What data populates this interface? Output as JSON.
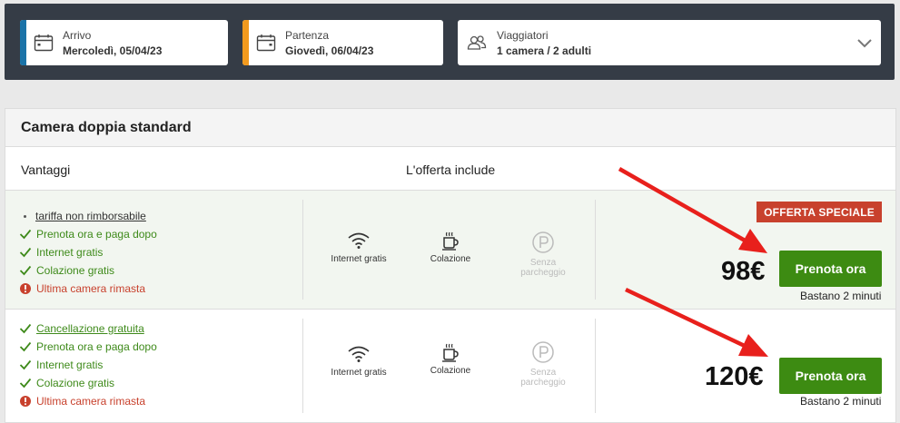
{
  "search": {
    "checkin": {
      "label": "Arrivo",
      "value": "Mercoledì, 05/04/23",
      "icon": "calendar-icon",
      "accent": "#1a73a8"
    },
    "checkout": {
      "label": "Partenza",
      "value": "Giovedì, 06/04/23",
      "icon": "calendar-icon",
      "accent": "#f29a1e"
    },
    "guests": {
      "label": "Viaggiatori",
      "value": "1 camera / 2 adulti",
      "icon": "users-icon"
    }
  },
  "room": {
    "title": "Camera doppia standard",
    "col_benefits": "Vantaggi",
    "col_includes": "L'offerta include"
  },
  "offers": [
    {
      "benefits": [
        {
          "text": "tariffa non rimborsabile",
          "kind": "bullet"
        },
        {
          "text": "Prenota ora e paga dopo",
          "kind": "check"
        },
        {
          "text": "Internet gratis",
          "kind": "check"
        },
        {
          "text": "Colazione gratis",
          "kind": "check"
        },
        {
          "text": "Ultima camera rimasta",
          "kind": "warning"
        }
      ],
      "amenities": [
        {
          "label": "Internet gratis",
          "icon": "wifi-icon",
          "available": true
        },
        {
          "label": "Colazione",
          "icon": "coffee-icon",
          "available": true
        },
        {
          "label": "Senza parcheggio",
          "icon": "parking-icon",
          "available": false
        }
      ],
      "badge": "OFFERTA SPECIALE",
      "price": "98€",
      "button": "Prenota ora",
      "hint": "Bastano 2 minuti"
    },
    {
      "benefits": [
        {
          "text": "Cancellazione gratuita",
          "kind": "check"
        },
        {
          "text": "Prenota ora e paga dopo",
          "kind": "check"
        },
        {
          "text": "Internet gratis",
          "kind": "check"
        },
        {
          "text": "Colazione gratis",
          "kind": "check"
        },
        {
          "text": "Ultima camera rimasta",
          "kind": "warning"
        }
      ],
      "amenities": [
        {
          "label": "Internet gratis",
          "icon": "wifi-icon",
          "available": true
        },
        {
          "label": "Colazione",
          "icon": "coffee-icon",
          "available": true
        },
        {
          "label": "Senza parcheggio",
          "icon": "parking-icon",
          "available": false
        }
      ],
      "price": "120€",
      "button": "Prenota ora",
      "hint": "Bastano 2 minuti"
    }
  ],
  "colors": {
    "green": "#3d8b12",
    "red": "#c8412d",
    "annotation": "#e8201c"
  }
}
